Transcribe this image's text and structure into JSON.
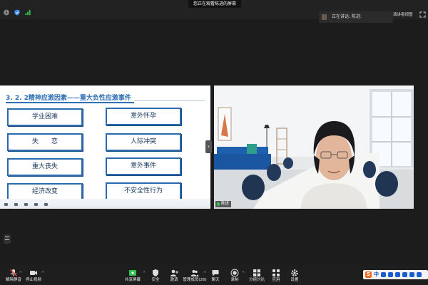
{
  "meeting": {
    "share_banner": "您正在观看陈进的屏幕",
    "speaker_indicator": "正在讲话: 陈进:",
    "gallery_view_label": "演讲者视图"
  },
  "slide": {
    "title_number": "3. 2. 2",
    "title_text": "精神应激因素——重大负性应激事件",
    "left_column": [
      "学业困难",
      "失　　恋",
      "重大丧失",
      "经济改变"
    ],
    "right_column": [
      "意外怀孕",
      "人际冲突",
      "意外事件",
      "不安全性行为"
    ]
  },
  "video": {
    "participant_name": "陈进"
  },
  "toolbar": {
    "mute_label": "解除静音",
    "stop_video_label": "停止视频",
    "share_screen_label": "共享屏幕",
    "security_label": "安全",
    "invite_label": "邀请",
    "participants_label": "管理成员(26)",
    "chat_label": "聊天",
    "record_label": "录制",
    "breakout_label": "分组讨论",
    "apps_label": "应用",
    "settings_label": "设置"
  },
  "tray": {
    "ime_logo": "S",
    "ime_lang": "中"
  },
  "colors": {
    "accent_blue": "#2a6aad",
    "share_green": "#2ec24c",
    "background": "#1c1c1c",
    "toolbar": "#1e1e1e"
  }
}
